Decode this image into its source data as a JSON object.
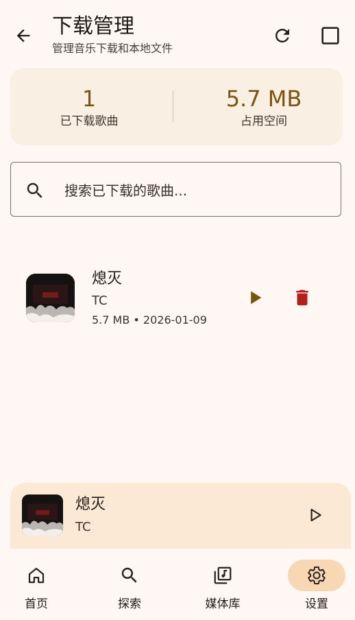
{
  "header": {
    "title": "下载管理",
    "subtitle": "管理音乐下载和本地文件"
  },
  "stats": {
    "count_value": "1",
    "count_label": "已下载歌曲",
    "size_value": "5.7 MB",
    "size_label": "占用空间"
  },
  "search": {
    "placeholder": "搜索已下载的歌曲..."
  },
  "songs": [
    {
      "title": "熄灭",
      "artist": "TC",
      "meta": "5.7 MB • 2026-01-09"
    }
  ],
  "mini_player": {
    "title": "熄灭",
    "artist": "TC"
  },
  "nav": [
    {
      "label": "首页",
      "icon": "home-icon"
    },
    {
      "label": "探索",
      "icon": "search-icon"
    },
    {
      "label": "媒体库",
      "icon": "library-music-icon"
    },
    {
      "label": "设置",
      "icon": "gear-icon",
      "active": true
    }
  ],
  "colors": {
    "background": "#fff7f3",
    "accent": "#7a5410",
    "stats_card": "#f9efe3",
    "mini_player": "#fbe9d6",
    "active_nav": "#f7d7b4",
    "delete": "#b3201c"
  }
}
